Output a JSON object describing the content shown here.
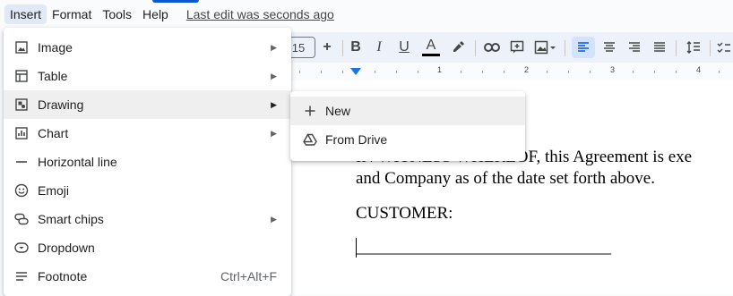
{
  "menubar": {
    "items": [
      "Insert",
      "Format",
      "Tools",
      "Help"
    ],
    "last_edit": "Last edit was seconds ago"
  },
  "toolbar": {
    "font_size": "15",
    "plus": "+",
    "bold": "B",
    "italic": "I",
    "underline": "U",
    "text_color": "A",
    "text_color_swatch": "#000000"
  },
  "ruler": {
    "numbers": [
      "1",
      "2",
      "3",
      "4"
    ]
  },
  "insert_menu": {
    "items": [
      {
        "label": "Image",
        "icon": "image-icon",
        "submenu": true
      },
      {
        "label": "Table",
        "icon": "table-icon",
        "submenu": true
      },
      {
        "label": "Drawing",
        "icon": "drawing-icon",
        "submenu": true
      },
      {
        "label": "Chart",
        "icon": "chart-icon",
        "submenu": true
      },
      {
        "label": "Horizontal line",
        "icon": "horizontal-line-icon",
        "submenu": false
      },
      {
        "label": "Emoji",
        "icon": "emoji-icon",
        "submenu": false
      },
      {
        "label": "Smart chips",
        "icon": "smart-chips-icon",
        "submenu": true
      },
      {
        "label": "Dropdown",
        "icon": "dropdown-icon",
        "submenu": false
      },
      {
        "label": "Footnote",
        "icon": "footnote-icon",
        "submenu": false,
        "shortcut": "Ctrl+Alt+F"
      }
    ]
  },
  "drawing_submenu": {
    "items": [
      {
        "label": "New",
        "icon": "plus-icon"
      },
      {
        "label": "From Drive",
        "icon": "drive-icon"
      }
    ]
  },
  "document": {
    "line1": "IN WITNESS WHEREOF, this Agreement is exe",
    "line2": "and Company as of the date set forth above.",
    "line3": "CUSTOMER:",
    "signature_line": "______________________________"
  },
  "colors": {
    "accent": "#0b57d0",
    "menu_hover": "#efefef",
    "toolbar_bg": "#edf2fa"
  }
}
